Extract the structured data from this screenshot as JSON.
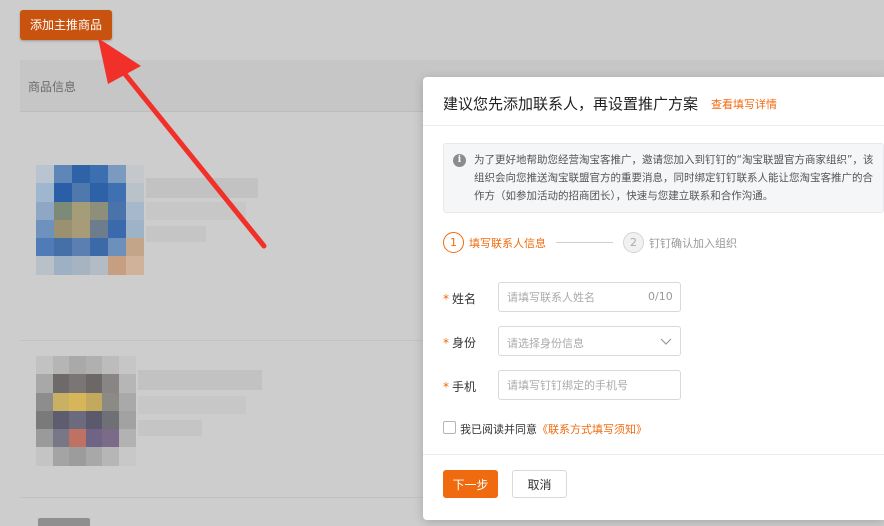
{
  "background": {
    "add_button_label": "添加主推商品",
    "table_header_label": "商品信息"
  },
  "modal": {
    "title": "建议您先添加联系人，再设置推广方案",
    "title_link": "查看填写详情",
    "notice_icon": "info-icon",
    "notice_text": "为了更好地帮助您经营淘宝客推广，邀请您加入到钉钉的“淘宝联盟官方商家组织”，该组织会向您推送淘宝联盟官方的重要消息，同时绑定钉钉联系人能让您淘宝客推广的合作方（如参加活动的招商团长），快速与您建立联系和合作沟通。",
    "steps": [
      {
        "number": "1",
        "label": "填写联系人信息",
        "active": true
      },
      {
        "number": "2",
        "label": "钉钉确认加入组织",
        "active": false
      }
    ],
    "form": {
      "required_mark": "*",
      "name": {
        "label": "姓名",
        "placeholder": "请填写联系人姓名",
        "value": "",
        "counter": "0/10"
      },
      "identity": {
        "label": "身份",
        "placeholder": "请选择身份信息"
      },
      "phone": {
        "label": "手机",
        "placeholder": "请填写钉钉绑定的手机号",
        "value": ""
      }
    },
    "agreement": {
      "text": "我已阅读并同意",
      "link": "《联系方式填写须知》",
      "checked": false
    },
    "buttons": {
      "next": "下一步",
      "cancel": "取消"
    }
  },
  "colors": {
    "accent": "#f06a0f",
    "add_button": "#c8530e",
    "arrow": "#f2302a"
  }
}
